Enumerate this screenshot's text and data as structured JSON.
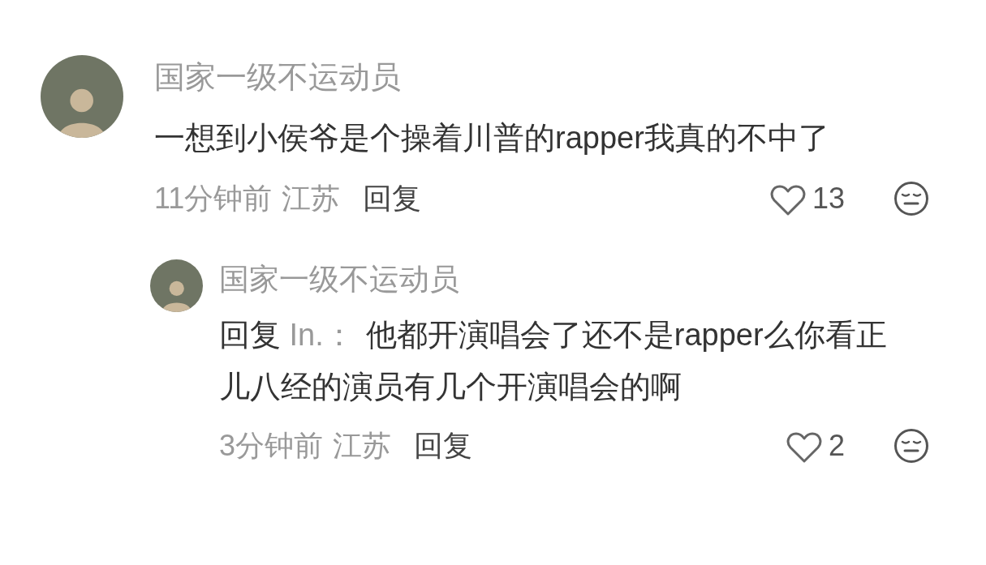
{
  "comments": [
    {
      "author": "国家一级不运动员",
      "text": "一想到小侯爷是个操着川普的rapper我真的不中了",
      "time": "11分钟前",
      "location": "江苏",
      "reply_label": "回复",
      "liked": false,
      "likes": "13",
      "replies": [
        {
          "author": "国家一级不运动员",
          "reply_prefix": "回复",
          "reply_to": "In.：",
          "text": "他都开演唱会了还不是rapper么你看正儿八经的演员有几个开演唱会的啊",
          "time": "3分钟前",
          "location": "江苏",
          "reply_label": "回复",
          "liked": false,
          "likes": "2"
        }
      ]
    }
  ]
}
